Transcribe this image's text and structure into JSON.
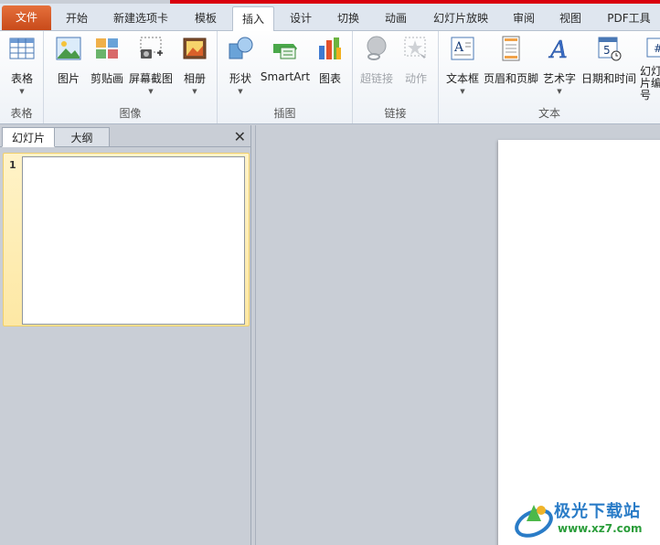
{
  "tabs": [
    {
      "label": "文件"
    },
    {
      "label": "开始"
    },
    {
      "label": "新建选项卡"
    },
    {
      "label": "模板"
    },
    {
      "label": "插入"
    },
    {
      "label": "设计"
    },
    {
      "label": "切换"
    },
    {
      "label": "动画"
    },
    {
      "label": "幻灯片放映"
    },
    {
      "label": "审阅"
    },
    {
      "label": "视图"
    },
    {
      "label": "PDF工具"
    }
  ],
  "ribbon": {
    "groups": {
      "table": "表格",
      "image": "图像",
      "illustrations": "插图",
      "links": "链接",
      "text": "文本"
    },
    "buttons": {
      "table": "表格",
      "picture": "图片",
      "clipart": "剪贴画",
      "screenshot": "屏幕截图",
      "album": "相册",
      "shapes": "形状",
      "smartart": "SmartArt",
      "chart": "图表",
      "hyperlink": "超链接",
      "action": "动作",
      "textbox": "文本框",
      "header_footer": "页眉和页脚",
      "wordart": "艺术字",
      "datetime": "日期和时间",
      "slide_number": "幻灯片编号"
    }
  },
  "panel": {
    "tab_slides": "幻灯片",
    "tab_outline": "大纲",
    "close": "✕",
    "slide_number": "1"
  },
  "watermark": {
    "title": "极光下载站",
    "url": "www.xz7.com"
  },
  "colors": {
    "file_tab": "#d2572a",
    "accent_red": "#d9000c",
    "selected_thumb": "#fde8a4"
  }
}
